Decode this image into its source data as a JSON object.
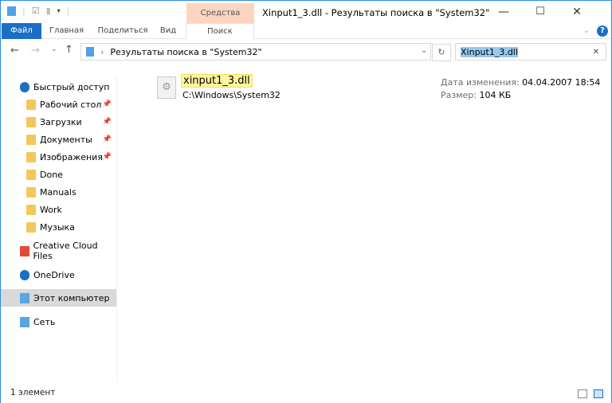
{
  "window": {
    "title": "Xinput1_3.dll - Результаты поиска в \"System32\"",
    "minimize": "—",
    "maximize": "☐",
    "close": "✕"
  },
  "ribbon": {
    "context_group": "Средства поиска",
    "tabs": [
      "Файл",
      "Главная",
      "Поделиться",
      "Вид",
      "Поиск"
    ],
    "help": "?"
  },
  "address": {
    "path": "Результаты поиска в \"System32\"",
    "search_value": "Xinput1_3.dll",
    "clear": "✕"
  },
  "sidebar": {
    "items": [
      {
        "label": "Быстрый доступ",
        "icon": "star-icon"
      },
      {
        "label": "Рабочий стол",
        "icon": "desktop-folder-icon",
        "pinned": true
      },
      {
        "label": "Загрузки",
        "icon": "downloads-folder-icon",
        "pinned": true
      },
      {
        "label": "Документы",
        "icon": "documents-folder-icon",
        "pinned": true
      },
      {
        "label": "Изображения",
        "icon": "pictures-folder-icon",
        "pinned": true
      },
      {
        "label": "Done",
        "icon": "folder-icon"
      },
      {
        "label": "Manuals",
        "icon": "folder-icon"
      },
      {
        "label": "Work",
        "icon": "folder-icon"
      },
      {
        "label": "Музыка",
        "icon": "music-folder-icon"
      },
      {
        "label": "Creative Cloud Files",
        "icon": "creative-cloud-icon"
      },
      {
        "label": "OneDrive",
        "icon": "cloud-icon"
      },
      {
        "label": "Этот компьютер",
        "icon": "computer-icon",
        "selected": true
      },
      {
        "label": "Сеть",
        "icon": "network-icon"
      }
    ]
  },
  "result": {
    "name": "xinput1_3.dll",
    "path": "C:\\Windows\\System32",
    "date_label": "Дата изменения:",
    "date": "04.04.2007 18:54",
    "size_label": "Размер:",
    "size": "104 КБ"
  },
  "status": {
    "count": "1 элемент"
  },
  "colors": {
    "accent": "#1a6fc4",
    "context_tab": "#fcd5c0",
    "highlight": "#fff59d",
    "selection": "#99c9ef"
  }
}
